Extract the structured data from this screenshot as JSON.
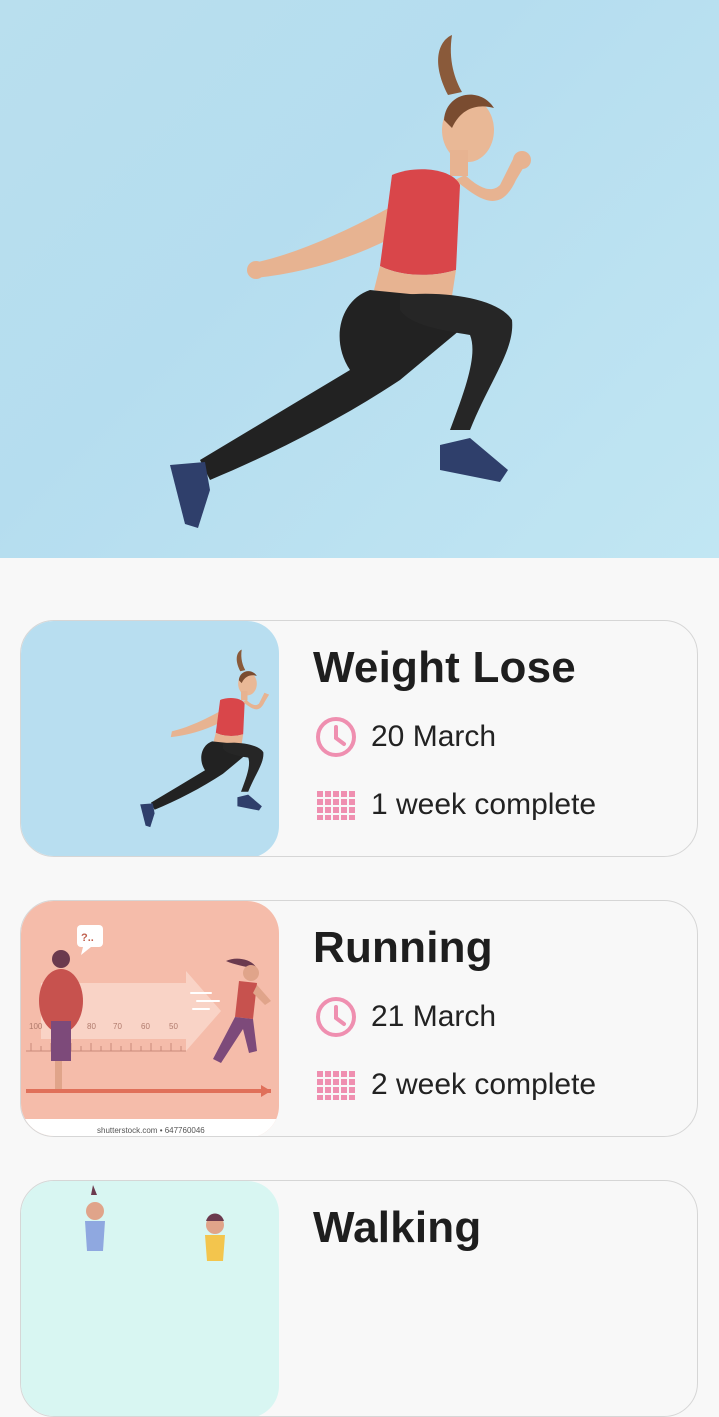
{
  "hero": {
    "image": "woman-jumping-photo"
  },
  "colors": {
    "accent": "#ef8fb0",
    "background": "#f8f8f8",
    "title": "#1e1e1e"
  },
  "workouts": [
    {
      "title": "Weight Lose",
      "date": "20 March",
      "progress": "1 week complete",
      "image": "woman-jumping-photo"
    },
    {
      "title": "Running",
      "date": "21 March",
      "progress": "2 week complete",
      "image": "running-illustration",
      "image_caption": "shutterstock.com • 647760046",
      "scale_labels": [
        "100",
        "80",
        "70",
        "60",
        "50"
      ],
      "speech_bubble": "?.."
    },
    {
      "title": "Walking",
      "image": "walking-illustration"
    }
  ],
  "icons": {
    "date": "clock-icon",
    "progress": "calendar-grid-icon"
  }
}
